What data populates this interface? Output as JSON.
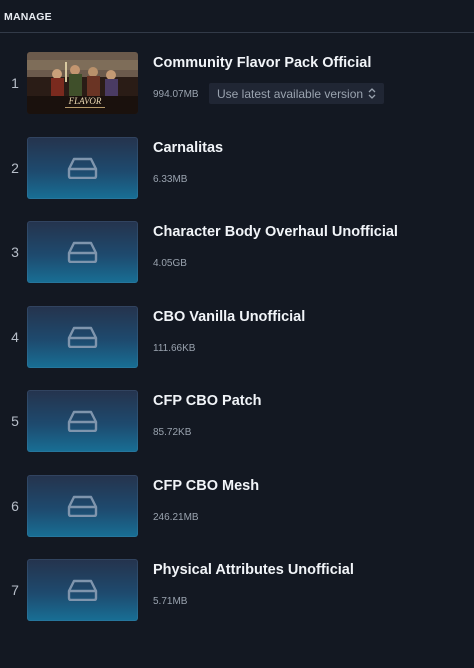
{
  "header": {
    "title": "MANAGE"
  },
  "mods": [
    {
      "index": "1",
      "title": "Community Flavor Pack Official",
      "size": "994.07MB",
      "thumbnail": "artwork",
      "version": "Use latest available version"
    },
    {
      "index": "2",
      "title": "Carnalitas",
      "size": "6.33MB",
      "thumbnail": "disk-icon"
    },
    {
      "index": "3",
      "title": "Character Body Overhaul Unofficial",
      "size": "4.05GB",
      "thumbnail": "disk-icon"
    },
    {
      "index": "4",
      "title": "CBO Vanilla Unofficial",
      "size": "111.66KB",
      "thumbnail": "disk-icon"
    },
    {
      "index": "5",
      "title": "CFP CBO Patch",
      "size": "85.72KB",
      "thumbnail": "disk-icon"
    },
    {
      "index": "6",
      "title": "CFP CBO Mesh",
      "size": "246.21MB",
      "thumbnail": "disk-icon"
    },
    {
      "index": "7",
      "title": "Physical Attributes Unofficial",
      "size": "5.71MB",
      "thumbnail": "disk-icon"
    }
  ],
  "colors": {
    "background": "#131822",
    "thumb_gradient_top": "#25334d",
    "thumb_gradient_bottom": "#186f95",
    "text_primary": "#f1f4f8",
    "text_secondary": "#9aa3af"
  }
}
